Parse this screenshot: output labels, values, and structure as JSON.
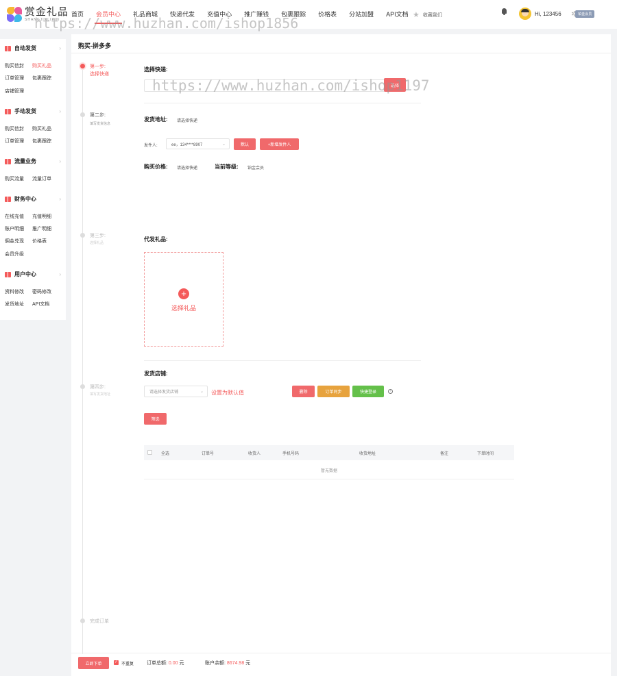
{
  "brand": {
    "name_cn": "赏金礼品",
    "name_en": "SHANGJINLIPIN"
  },
  "nav": [
    "首页",
    "会员中心",
    "礼品商城",
    "快递代发",
    "充值中心",
    "推广赚钱",
    "包裹跟踪",
    "价格表",
    "分站加盟",
    "API文档"
  ],
  "header": {
    "favorite": "收藏我们",
    "user": "Hi, 123456",
    "badge": "铂金会员"
  },
  "watermarks": [
    "https://www.huzhan.com/ishop1856",
    "https://www.huzhan.com/ishop1197"
  ],
  "sidebar": {
    "sections": [
      {
        "title": "自动发货",
        "items": [
          "购买信封",
          "购买礼品",
          "订单管理",
          "包裹跟踪",
          "店铺管理"
        ]
      },
      {
        "title": "手动发货",
        "items": [
          "购买信封",
          "购买礼品",
          "订单管理",
          "包裹跟踪"
        ]
      },
      {
        "title": "流量业务",
        "items": [
          "购买流量",
          "流量订单"
        ]
      },
      {
        "title": "财务中心",
        "items": [
          "在线充值",
          "充值明细",
          "账户明细",
          "推广明细",
          "佣金兑现",
          "价格表",
          "会员升级"
        ]
      },
      {
        "title": "用户中心",
        "items": [
          "资料修改",
          "密码修改",
          "发货地址",
          "API文档"
        ]
      }
    ]
  },
  "page": {
    "title": "购买-拼多多"
  },
  "steps": [
    {
      "title": "第一步:",
      "sub": "选择快递"
    },
    {
      "title": "第二步:",
      "sub": "填写发货信息"
    },
    {
      "title": "第三步:",
      "sub": "选择礼品"
    },
    {
      "title": "第四步:",
      "sub": "填写发货地址"
    },
    {
      "title": "完成订单",
      "sub": ""
    }
  ],
  "express": {
    "label": "选择快递:",
    "select_btn": "选择"
  },
  "address": {
    "label": "发货地址:",
    "value": "请选择快递",
    "sender_label": "发件人:",
    "sender_value": "ee，134****8907",
    "default_btn": "默认",
    "new_btn": "+新增发件人"
  },
  "price": {
    "label": "购买价格:",
    "value": "请选择快递",
    "level_label": "当前等级:",
    "level_value": "铂金会员"
  },
  "gift": {
    "label": "代发礼品:",
    "select_text": "选择礼品"
  },
  "shop": {
    "label": "发货店铺:",
    "select_placeholder": "请选择发货店铺",
    "set_default": "设置为默认值",
    "delete_btn": "删除",
    "sync_btn": "订单同步",
    "quick_btn": "快捷登录",
    "filter_btn": "筛选"
  },
  "table": {
    "columns": [
      "全选",
      "订单号",
      "收货人",
      "手机号码",
      "收货地址",
      "备注",
      "下单时间"
    ],
    "empty": "暂无数据"
  },
  "footer": {
    "submit_btn": "立即下单",
    "no_repeat": "不重复",
    "total_label": "订单总额:",
    "total_value": "0.00",
    "unit": "元",
    "balance_label": "账户余额:",
    "balance_value": "8674.98"
  },
  "colors": {
    "accent": "#f45a5a",
    "orange": "#e7a33e",
    "green": "#64c04a"
  }
}
